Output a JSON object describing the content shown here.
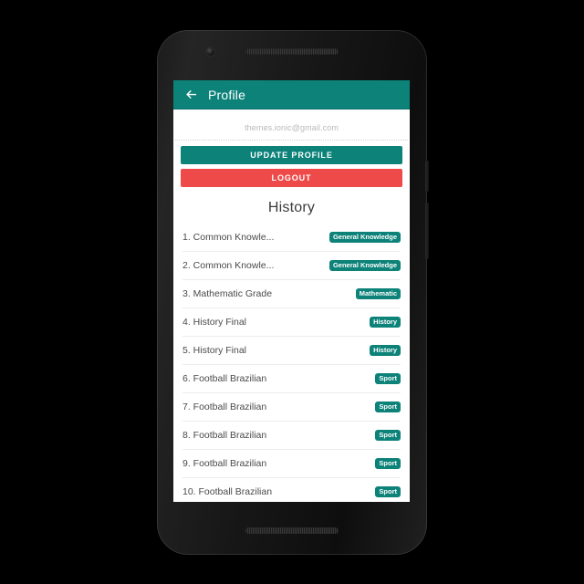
{
  "device": {
    "name": "android-phone-mockup",
    "earpiece": "speaker-grille",
    "camera": "front-camera",
    "power_button": "power-button",
    "volume_button": "volume-button"
  },
  "header": {
    "title": "Profile",
    "back_icon": "arrow-left-icon",
    "background": "#0c8279"
  },
  "profile": {
    "email": "themes.ionic@gmail.com",
    "update_label": "UPDATE PROFILE",
    "logout_label": "LOGOUT",
    "update_color": "#0c8279",
    "logout_color": "#ef4a4a"
  },
  "history": {
    "title": "History",
    "items": [
      {
        "label": "1. Common Knowle...",
        "badge": "General Knowledge"
      },
      {
        "label": "2. Common Knowle...",
        "badge": "General Knowledge"
      },
      {
        "label": "3. Mathematic Grade",
        "badge": "Mathematic"
      },
      {
        "label": "4. History Final",
        "badge": "History"
      },
      {
        "label": "5. History Final",
        "badge": "History"
      },
      {
        "label": "6. Football Brazilian",
        "badge": "Sport"
      },
      {
        "label": "7. Football Brazilian",
        "badge": "Sport"
      },
      {
        "label": "8. Football Brazilian",
        "badge": "Sport"
      },
      {
        "label": "9. Football Brazilian",
        "badge": "Sport"
      },
      {
        "label": "10. Football Brazilian",
        "badge": "Sport"
      }
    ]
  }
}
